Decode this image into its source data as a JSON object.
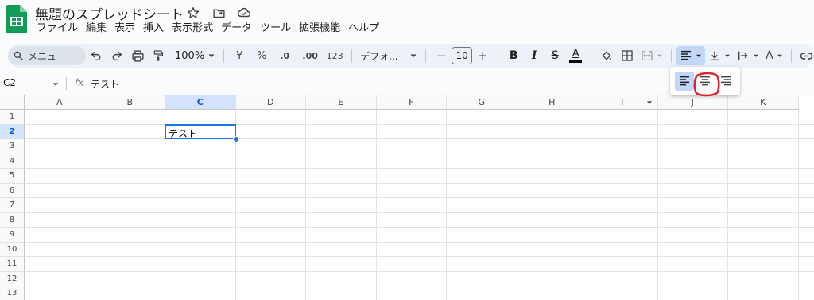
{
  "app": {
    "title": "無題のスプレッドシート",
    "accent_color": "#1a73e8",
    "brand_color": "#0f9d58"
  },
  "title_icons": [
    "star-icon",
    "move-to-folder-icon",
    "cloud-saved-icon"
  ],
  "menu": [
    "ファイル",
    "編集",
    "表示",
    "挿入",
    "表示形式",
    "データ",
    "ツール",
    "拡張機能",
    "ヘルプ"
  ],
  "toolbar": {
    "search_label": "メニュー",
    "zoom": "100%",
    "currency": "¥",
    "percent": "%",
    "decrease_decimal": ".0",
    "increase_decimal": ".00",
    "number_format": "123",
    "font": "デフォ...",
    "font_size": "10",
    "minus": "−",
    "plus": "+",
    "bold": "B",
    "italic": "I",
    "strike": "S",
    "text_color_letter": "A",
    "text_rotation_letter": "A"
  },
  "formula_bar": {
    "cell_ref": "C2",
    "fx": "fx",
    "value": "テスト"
  },
  "grid": {
    "columns": [
      "A",
      "B",
      "C",
      "D",
      "E",
      "F",
      "G",
      "H",
      "I",
      "J",
      "K"
    ],
    "rows": [
      "1",
      "2",
      "3",
      "4",
      "5",
      "6",
      "7",
      "8",
      "9",
      "10",
      "11",
      "12",
      "13"
    ],
    "selected_column": "C",
    "selected_row": "2",
    "cells": {
      "C2": "テスト"
    }
  },
  "align_popup": {
    "options": [
      "left",
      "center",
      "right"
    ],
    "selected": "left",
    "annotated": "center",
    "annotation_color": "#e0242b"
  }
}
